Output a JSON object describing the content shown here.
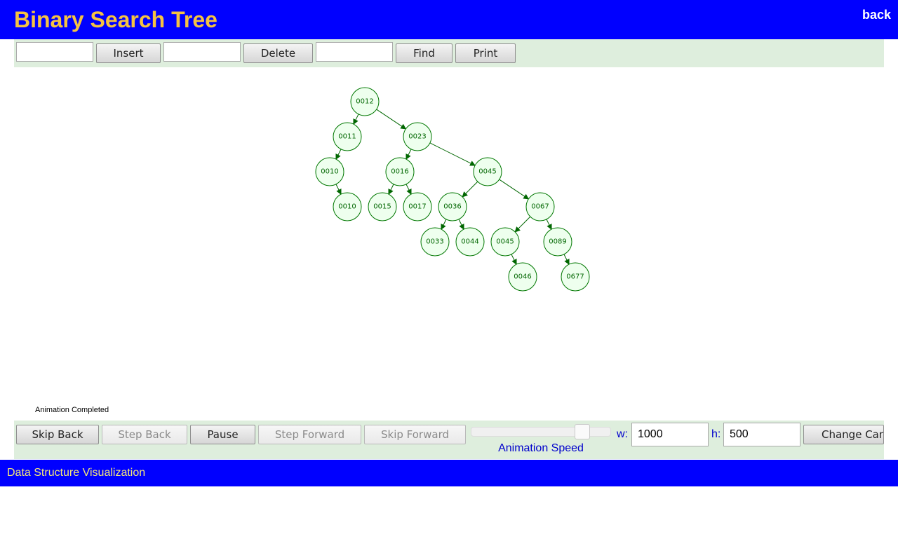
{
  "header": {
    "title": "Binary Search Tree",
    "back_label": "back",
    "background_color": "#0000ff",
    "title_color": "#f5c242"
  },
  "toolbar": {
    "insert_value": "",
    "insert_label": "Insert",
    "delete_value": "",
    "delete_label": "Delete",
    "find_value": "",
    "find_label": "Find",
    "print_label": "Print"
  },
  "tree": {
    "node_fill": "#eeffee",
    "node_stroke": "#007700",
    "nodes": [
      {
        "id": "n12",
        "label": "0012",
        "depth": 0,
        "slot": 4
      },
      {
        "id": "n11",
        "label": "0011",
        "depth": 1,
        "slot": 3
      },
      {
        "id": "n23",
        "label": "0023",
        "depth": 1,
        "slot": 7
      },
      {
        "id": "n10a",
        "label": "0010",
        "depth": 2,
        "slot": 2
      },
      {
        "id": "n16",
        "label": "0016",
        "depth": 2,
        "slot": 6
      },
      {
        "id": "n45a",
        "label": "0045",
        "depth": 2,
        "slot": 11
      },
      {
        "id": "n10b",
        "label": "0010",
        "depth": 3,
        "slot": 3
      },
      {
        "id": "n15",
        "label": "0015",
        "depth": 3,
        "slot": 5
      },
      {
        "id": "n17",
        "label": "0017",
        "depth": 3,
        "slot": 7
      },
      {
        "id": "n36",
        "label": "0036",
        "depth": 3,
        "slot": 9
      },
      {
        "id": "n67",
        "label": "0067",
        "depth": 3,
        "slot": 14
      },
      {
        "id": "n33",
        "label": "0033",
        "depth": 4,
        "slot": 8
      },
      {
        "id": "n44",
        "label": "0044",
        "depth": 4,
        "slot": 10
      },
      {
        "id": "n45b",
        "label": "0045",
        "depth": 4,
        "slot": 12
      },
      {
        "id": "n89",
        "label": "0089",
        "depth": 4,
        "slot": 15
      },
      {
        "id": "n46",
        "label": "0046",
        "depth": 5,
        "slot": 13
      },
      {
        "id": "n677",
        "label": "0677",
        "depth": 5,
        "slot": 16
      }
    ],
    "edges": [
      [
        "n12",
        "n11"
      ],
      [
        "n12",
        "n23"
      ],
      [
        "n11",
        "n10a"
      ],
      [
        "n23",
        "n16"
      ],
      [
        "n23",
        "n45a"
      ],
      [
        "n10a",
        "n10b"
      ],
      [
        "n16",
        "n15"
      ],
      [
        "n16",
        "n17"
      ],
      [
        "n45a",
        "n36"
      ],
      [
        "n45a",
        "n67"
      ],
      [
        "n36",
        "n33"
      ],
      [
        "n36",
        "n44"
      ],
      [
        "n67",
        "n45b"
      ],
      [
        "n67",
        "n89"
      ],
      [
        "n45b",
        "n46"
      ],
      [
        "n89",
        "n677"
      ]
    ]
  },
  "status": {
    "message": "Animation Completed"
  },
  "controls": {
    "skip_back_label": "Skip Back",
    "step_back_label": "Step Back",
    "pause_label": "Pause",
    "step_forward_label": "Step Forward",
    "skip_forward_label": "Skip Forward",
    "speed_label": "Animation Speed",
    "speed_level": 0.8,
    "width_label": "w:",
    "width_value": "1000",
    "height_label": "h:",
    "height_value": "500",
    "change_canvas_label": "Change Canvas Size"
  },
  "footer": {
    "text": "Data Structure Visualization"
  }
}
